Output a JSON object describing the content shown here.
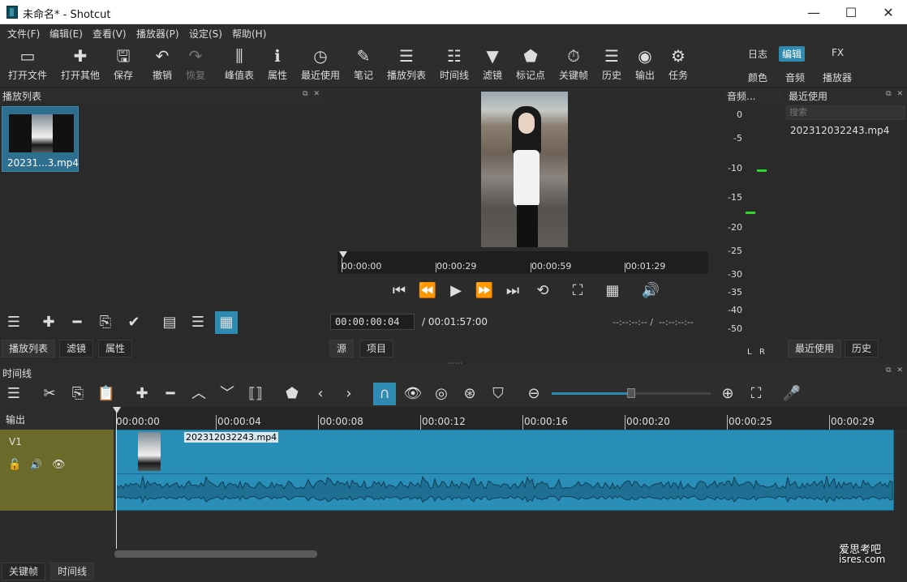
{
  "window": {
    "title": "未命名* - Shotcut",
    "min": "—",
    "max": "☐",
    "close": "✕"
  },
  "menu": [
    "文件(F)",
    "编辑(E)",
    "查看(V)",
    "播放器(P)",
    "设定(S)",
    "帮助(H)"
  ],
  "toolbar": [
    {
      "label": "打开文件",
      "icon": "folder-icon",
      "glyph": "▭"
    },
    {
      "label": "打开其他",
      "icon": "open-other-icon",
      "glyph": "✚"
    },
    {
      "label": "保存",
      "icon": "save-icon",
      "glyph": "🖫"
    },
    {
      "label": "撤销",
      "icon": "undo-icon",
      "glyph": "↶"
    },
    {
      "label": "恢复",
      "icon": "redo-icon",
      "glyph": "↷"
    },
    {
      "label": "峰值表",
      "icon": "peak-meter-icon",
      "glyph": "⫼"
    },
    {
      "label": "属性",
      "icon": "info-icon",
      "glyph": "ℹ"
    },
    {
      "label": "最近使用",
      "icon": "clock-icon",
      "glyph": "◷"
    },
    {
      "label": "笔记",
      "icon": "notes-icon",
      "glyph": "✎"
    },
    {
      "label": "播放列表",
      "icon": "list-icon",
      "glyph": "☰"
    },
    {
      "label": "时间线",
      "icon": "timeline-icon",
      "glyph": "☷"
    },
    {
      "label": "滤镜",
      "icon": "filter-icon",
      "glyph": "▼"
    },
    {
      "label": "标记点",
      "icon": "marker-icon",
      "glyph": "⬟"
    },
    {
      "label": "关键帧",
      "icon": "stopwatch-icon",
      "glyph": "⏱"
    },
    {
      "label": "历史",
      "icon": "history-icon",
      "glyph": "☰"
    },
    {
      "label": "输出",
      "icon": "export-icon",
      "glyph": "◉"
    },
    {
      "label": "任务",
      "icon": "gear-icon",
      "glyph": "⚙"
    }
  ],
  "layouts": {
    "top": [
      "日志",
      "编辑",
      "FX"
    ],
    "bottom": [
      "颜色",
      "音频",
      "播放器"
    ],
    "active": "编辑"
  },
  "playlist": {
    "title": "播放列表",
    "item_label": "20231...3.mp4",
    "tabs": [
      "播放列表",
      "滤镜",
      "属性"
    ]
  },
  "player": {
    "ruler": [
      "00:00:00",
      "00:00:29",
      "00:00:59",
      "00:01:29"
    ],
    "current_time": "00:00:00:04",
    "total": "/ 00:01:57:00",
    "in_out": "--:--:--:-- /  --:--:--:--",
    "tabs": [
      "源",
      "项目"
    ]
  },
  "audio": {
    "title": "音频...",
    "scale": [
      "0",
      "-5",
      "-10",
      "-15",
      "-20",
      "-25",
      "-30",
      "-35",
      "-40",
      "-50"
    ],
    "channels": [
      "L",
      "R"
    ]
  },
  "recent": {
    "title": "最近使用",
    "search_placeholder": "搜索",
    "items": [
      "202312032243.mp4"
    ],
    "tabs": [
      "最近使用",
      "历史"
    ]
  },
  "timeline": {
    "title": "时间线",
    "output_label": "输出",
    "track_label": "V1",
    "ruler": [
      "00:00:00",
      "00:00:04",
      "00:00:08",
      "00:00:12",
      "00:00:16",
      "00:00:20",
      "00:00:25",
      "00:00:29"
    ],
    "clip_name": "202312032243.mp4",
    "zoom_level": 0.5
  },
  "bottom_tabs": [
    "关键帧",
    "时间线"
  ],
  "watermark": {
    "line1": "爱思考吧",
    "line2": "isres.com"
  },
  "colors": {
    "accent": "#2e8ab0",
    "clip": "#2a8fb8",
    "track_header": "#6b6a2a",
    "meter_green": "#2bd82b"
  }
}
